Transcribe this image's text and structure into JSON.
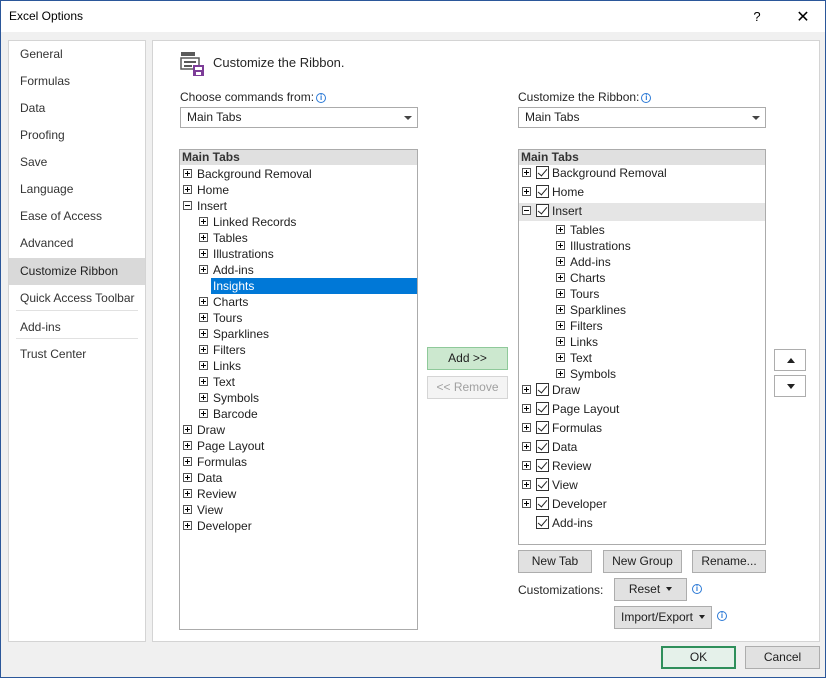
{
  "window": {
    "title": "Excel Options",
    "help_label": "?",
    "close_label": "✕"
  },
  "nav": {
    "items": [
      {
        "label": "General"
      },
      {
        "label": "Formulas"
      },
      {
        "label": "Data"
      },
      {
        "label": "Proofing"
      },
      {
        "label": "Save"
      },
      {
        "label": "Language"
      },
      {
        "label": "Ease of Access"
      },
      {
        "label": "Advanced"
      },
      {
        "label": "Customize Ribbon",
        "selected": true
      },
      {
        "label": "Quick Access Toolbar"
      },
      {
        "label": "Add-ins"
      },
      {
        "label": "Trust Center"
      }
    ]
  },
  "content": {
    "title": "Customize the Ribbon.",
    "left_label": "Choose commands from:",
    "left_combo_value": "Main Tabs",
    "right_label": "Customize the Ribbon:",
    "right_combo_value": "Main Tabs",
    "left_list": {
      "header": "Main Tabs",
      "items": [
        {
          "label": "Background Removal",
          "level": 0,
          "expander": "plus"
        },
        {
          "label": "Home",
          "level": 0,
          "expander": "plus"
        },
        {
          "label": "Insert",
          "level": 0,
          "expander": "minus"
        },
        {
          "label": "Linked Records",
          "level": 1,
          "expander": "plus"
        },
        {
          "label": "Tables",
          "level": 1,
          "expander": "plus"
        },
        {
          "label": "Illustrations",
          "level": 1,
          "expander": "plus"
        },
        {
          "label": "Add-ins",
          "level": 1,
          "expander": "plus"
        },
        {
          "label": "Insights",
          "level": 1,
          "expander": "none",
          "selected": true
        },
        {
          "label": "Charts",
          "level": 1,
          "expander": "plus"
        },
        {
          "label": "Tours",
          "level": 1,
          "expander": "plus"
        },
        {
          "label": "Sparklines",
          "level": 1,
          "expander": "plus"
        },
        {
          "label": "Filters",
          "level": 1,
          "expander": "plus"
        },
        {
          "label": "Links",
          "level": 1,
          "expander": "plus"
        },
        {
          "label": "Text",
          "level": 1,
          "expander": "plus"
        },
        {
          "label": "Symbols",
          "level": 1,
          "expander": "plus"
        },
        {
          "label": "Barcode",
          "level": 1,
          "expander": "plus"
        },
        {
          "label": "Draw",
          "level": 0,
          "expander": "plus"
        },
        {
          "label": "Page Layout",
          "level": 0,
          "expander": "plus"
        },
        {
          "label": "Formulas",
          "level": 0,
          "expander": "plus"
        },
        {
          "label": "Data",
          "level": 0,
          "expander": "plus"
        },
        {
          "label": "Review",
          "level": 0,
          "expander": "plus"
        },
        {
          "label": "View",
          "level": 0,
          "expander": "plus"
        },
        {
          "label": "Developer",
          "level": 0,
          "expander": "plus"
        }
      ]
    },
    "right_list": {
      "header": "Main Tabs",
      "items": [
        {
          "label": "Background Removal",
          "level": 0,
          "expander": "plus",
          "checked": true
        },
        {
          "label": "Home",
          "level": 0,
          "expander": "plus",
          "checked": true
        },
        {
          "label": "Insert",
          "level": 0,
          "expander": "minus",
          "checked": true,
          "highlighted": true
        },
        {
          "label": "Tables",
          "level": 1,
          "expander": "plus"
        },
        {
          "label": "Illustrations",
          "level": 1,
          "expander": "plus"
        },
        {
          "label": "Add-ins",
          "level": 1,
          "expander": "plus"
        },
        {
          "label": "Charts",
          "level": 1,
          "expander": "plus"
        },
        {
          "label": "Tours",
          "level": 1,
          "expander": "plus"
        },
        {
          "label": "Sparklines",
          "level": 1,
          "expander": "plus"
        },
        {
          "label": "Filters",
          "level": 1,
          "expander": "plus"
        },
        {
          "label": "Links",
          "level": 1,
          "expander": "plus"
        },
        {
          "label": "Text",
          "level": 1,
          "expander": "plus"
        },
        {
          "label": "Symbols",
          "level": 1,
          "expander": "plus"
        },
        {
          "label": "Draw",
          "level": 0,
          "expander": "plus",
          "checked": true
        },
        {
          "label": "Page Layout",
          "level": 0,
          "expander": "plus",
          "checked": true
        },
        {
          "label": "Formulas",
          "level": 0,
          "expander": "plus",
          "checked": true
        },
        {
          "label": "Data",
          "level": 0,
          "expander": "plus",
          "checked": true
        },
        {
          "label": "Review",
          "level": 0,
          "expander": "plus",
          "checked": true
        },
        {
          "label": "View",
          "level": 0,
          "expander": "plus",
          "checked": true
        },
        {
          "label": "Developer",
          "level": 0,
          "expander": "plus",
          "checked": true
        },
        {
          "label": "Add-ins",
          "level": 0,
          "expander": "none",
          "checked": true
        }
      ]
    },
    "add_label": "Add >>",
    "remove_label": "<< Remove",
    "new_tab_label": "New Tab",
    "new_group_label": "New Group",
    "rename_label": "Rename...",
    "customizations_label": "Customizations:",
    "reset_label": "Reset",
    "import_export_label": "Import/Export"
  },
  "footer": {
    "ok_label": "OK",
    "cancel_label": "Cancel"
  },
  "colors": {
    "selection": "#0078d7",
    "accent_border": "#2b579a",
    "add_button": "#cce8cf"
  }
}
